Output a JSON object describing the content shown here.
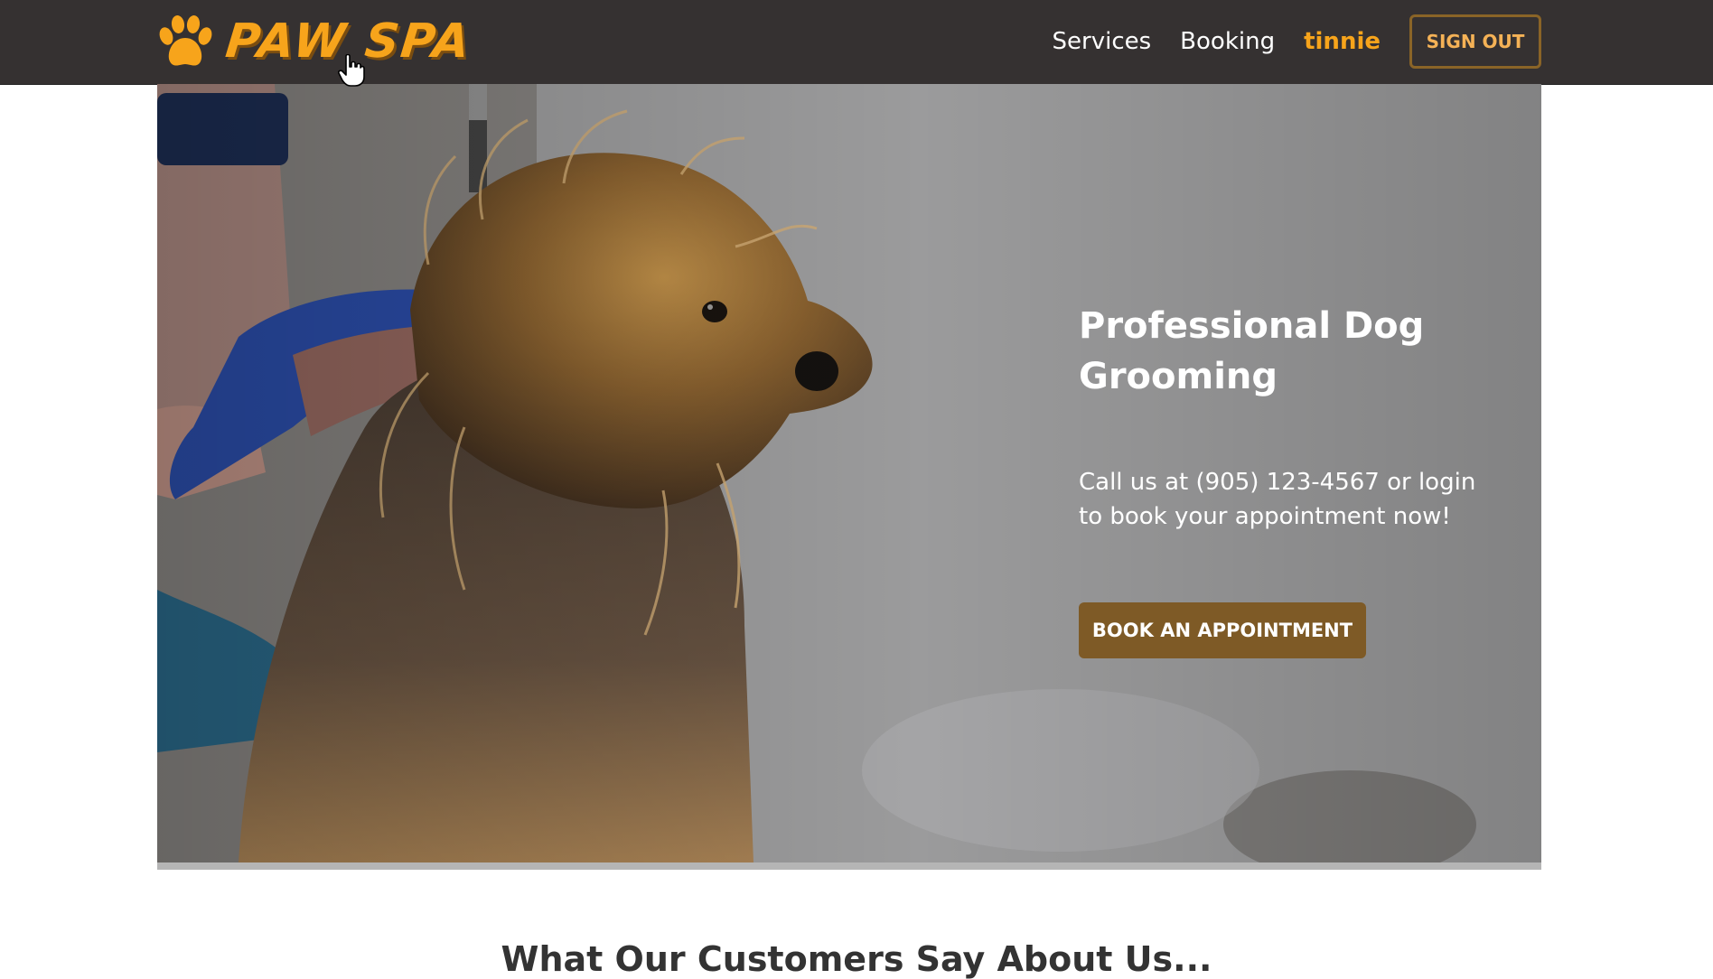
{
  "header": {
    "brand": "PAW SPA",
    "logo_icon": "paw-icon",
    "nav": {
      "services": "Services",
      "booking": "Booking",
      "user": "tinnie",
      "sign_out": "SIGN OUT"
    }
  },
  "hero": {
    "title": "Professional Dog Grooming",
    "text": "Call us at (905) 123-4567 or login to book your appointment now!",
    "cta": "BOOK AN APPOINTMENT",
    "image": "dog-grooming-photo"
  },
  "testimonials": {
    "heading": "What Our Customers Say About Us..."
  },
  "colors": {
    "navbar": "#353131",
    "brand": "#f7a41b",
    "button": "#7e5a26",
    "signout_border": "#8a6427"
  }
}
